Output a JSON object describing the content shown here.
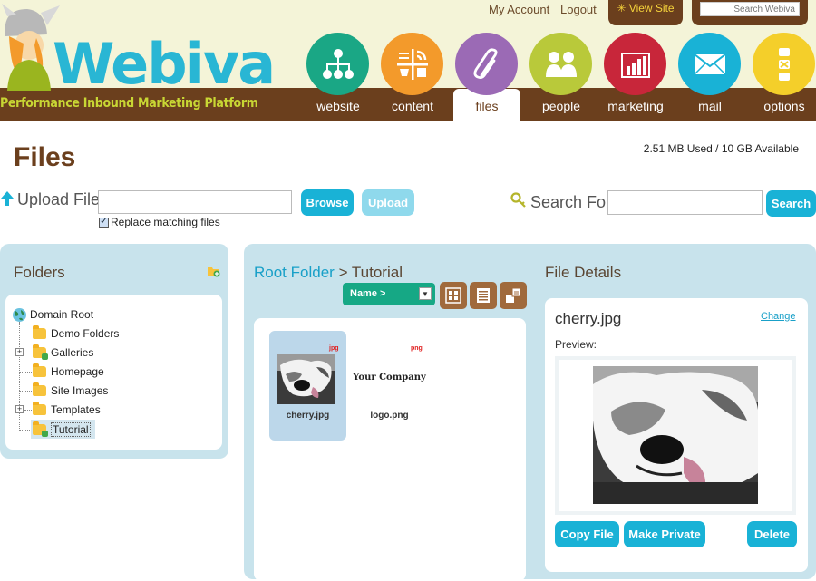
{
  "header": {
    "brand": "Webiva",
    "tagline": "Performance Inbound Marketing Platform",
    "my_account": "My Account",
    "logout": "Logout",
    "view_site": "✳ View Site",
    "search_placeholder": "Search Webiva"
  },
  "nav": {
    "items": [
      {
        "label": "website",
        "color": "#1aa785",
        "icon": "sitemap-icon"
      },
      {
        "label": "content",
        "color": "#f39a2b",
        "icon": "content-grid-icon"
      },
      {
        "label": "files",
        "color": "#9b6ab5",
        "icon": "paperclip-icon",
        "active": true
      },
      {
        "label": "people",
        "color": "#b9c93a",
        "icon": "people-icon"
      },
      {
        "label": "marketing",
        "color": "#c8263a",
        "icon": "bar-chart-icon"
      },
      {
        "label": "mail",
        "color": "#19b2d6",
        "icon": "envelope-icon"
      },
      {
        "label": "options",
        "color": "#f4cf2a",
        "icon": "options-icon"
      }
    ]
  },
  "page": {
    "title": "Files",
    "storage": "2.51 MB Used / 10 GB Available"
  },
  "upload": {
    "label": "Upload File",
    "browse": "Browse",
    "upload": "Upload",
    "replace_label": "Replace matching files",
    "replace_checked": true
  },
  "search": {
    "label": "Search For",
    "button": "Search",
    "value": ""
  },
  "folders": {
    "title": "Folders",
    "root": "Domain Root",
    "items": [
      {
        "label": "Demo Folders",
        "expandable": false
      },
      {
        "label": "Galleries",
        "expandable": true,
        "gallery": true
      },
      {
        "label": "Homepage",
        "expandable": false
      },
      {
        "label": "Site Images",
        "expandable": false
      },
      {
        "label": "Templates",
        "expandable": true
      },
      {
        "label": "Tutorial",
        "expandable": false,
        "gallery": true,
        "selected": true
      }
    ]
  },
  "browser": {
    "breadcrumb_root": "Root Folder",
    "breadcrumb_sep": ">",
    "breadcrumb_current": "Tutorial",
    "sort_label": "Name >",
    "files": [
      {
        "name": "cherry.jpg",
        "ext": "jpg",
        "selected": true
      },
      {
        "name": "logo.png",
        "ext": "png",
        "preview_text": "Your Company",
        "selected": false
      }
    ]
  },
  "details": {
    "title": "File Details",
    "file_name": "cherry.jpg",
    "change": "Change",
    "preview_label": "Preview:",
    "copy": "Copy File",
    "private": "Make Private",
    "delete": "Delete"
  }
}
